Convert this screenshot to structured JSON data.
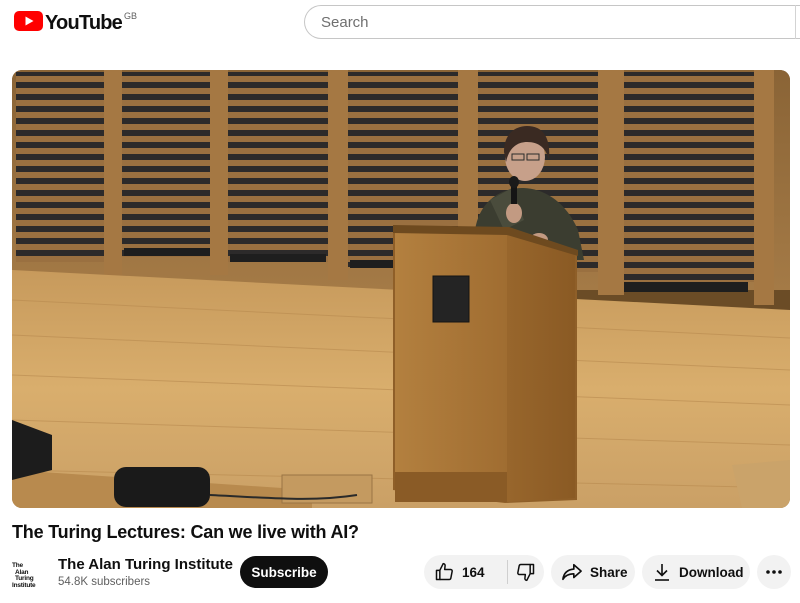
{
  "header": {
    "logo_text": "YouTube",
    "region_code": "GB",
    "search_placeholder": "Search"
  },
  "video": {
    "title": "The Turing Lectures: Can we live with AI?"
  },
  "channel": {
    "logo_line1": "The",
    "logo_line2": "Alan Turing",
    "logo_line3": "Institute",
    "name": "The Alan Turing Institute",
    "subscribers": "54.8K subscribers",
    "subscribe_label": "Subscribe"
  },
  "actions": {
    "like_count": "164",
    "share_label": "Share",
    "download_label": "Download"
  },
  "icons": {
    "logo": "youtube-play-icon",
    "like": "thumbs-up-icon",
    "dislike": "thumbs-down-icon",
    "share": "share-arrow-icon",
    "download": "download-icon",
    "more": "more-horizontal-icon"
  },
  "colors": {
    "brand_red": "#ff0000",
    "subscribe_bg": "#0f0f0f",
    "pill_bg": "#f2f2f2"
  }
}
